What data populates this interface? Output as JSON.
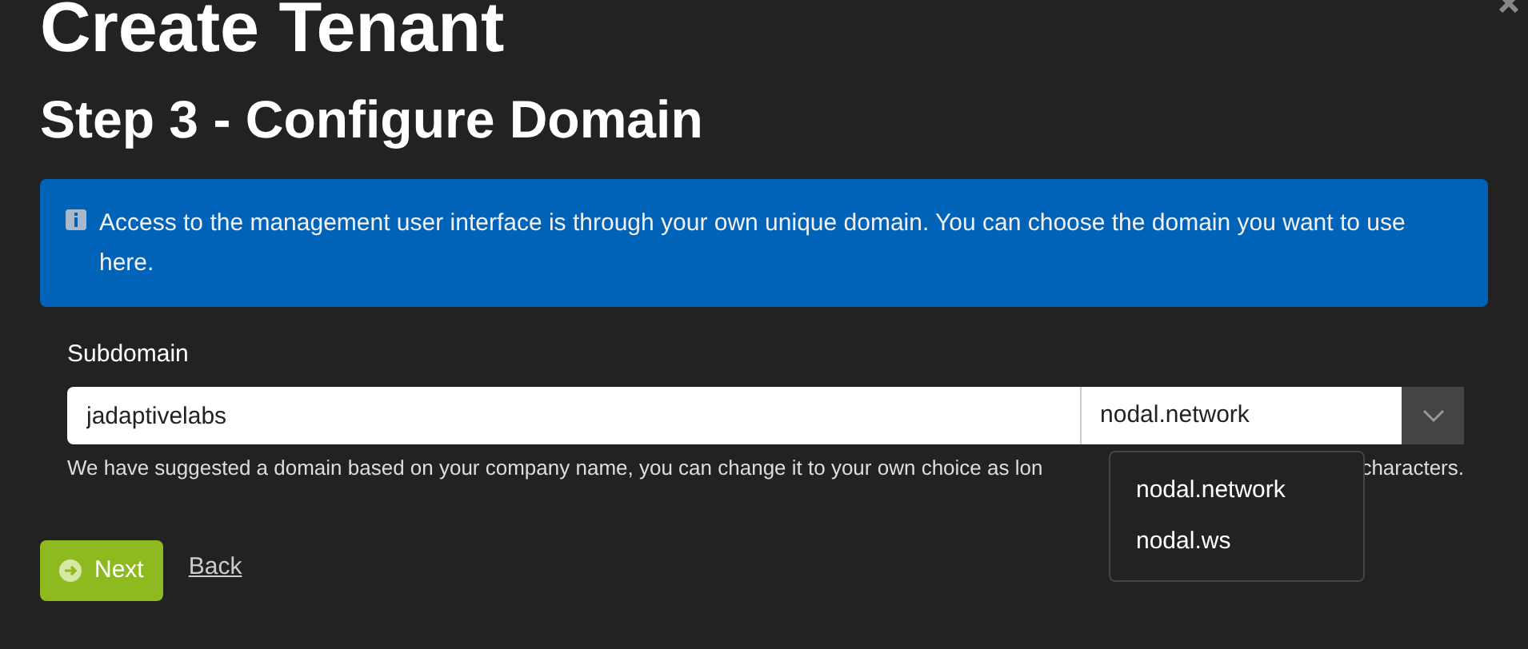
{
  "title": "Create Tenant",
  "subtitle": "Step 3 - Configure Domain",
  "info": "Access to the management user interface is through your own unique domain. You can choose the domain you want to use here.",
  "subdomain": {
    "label": "Subdomain",
    "value": "jadaptivelabs",
    "domain_value": "nodal.network",
    "hint_before": "We have suggested a domain based on your company name, you can change it to your own choice as lon",
    "hint_after": "characters.",
    "menu_expanded": true,
    "options": [
      "nodal.network",
      "nodal.ws"
    ]
  },
  "buttons": {
    "next": "Next",
    "back": "Back"
  }
}
